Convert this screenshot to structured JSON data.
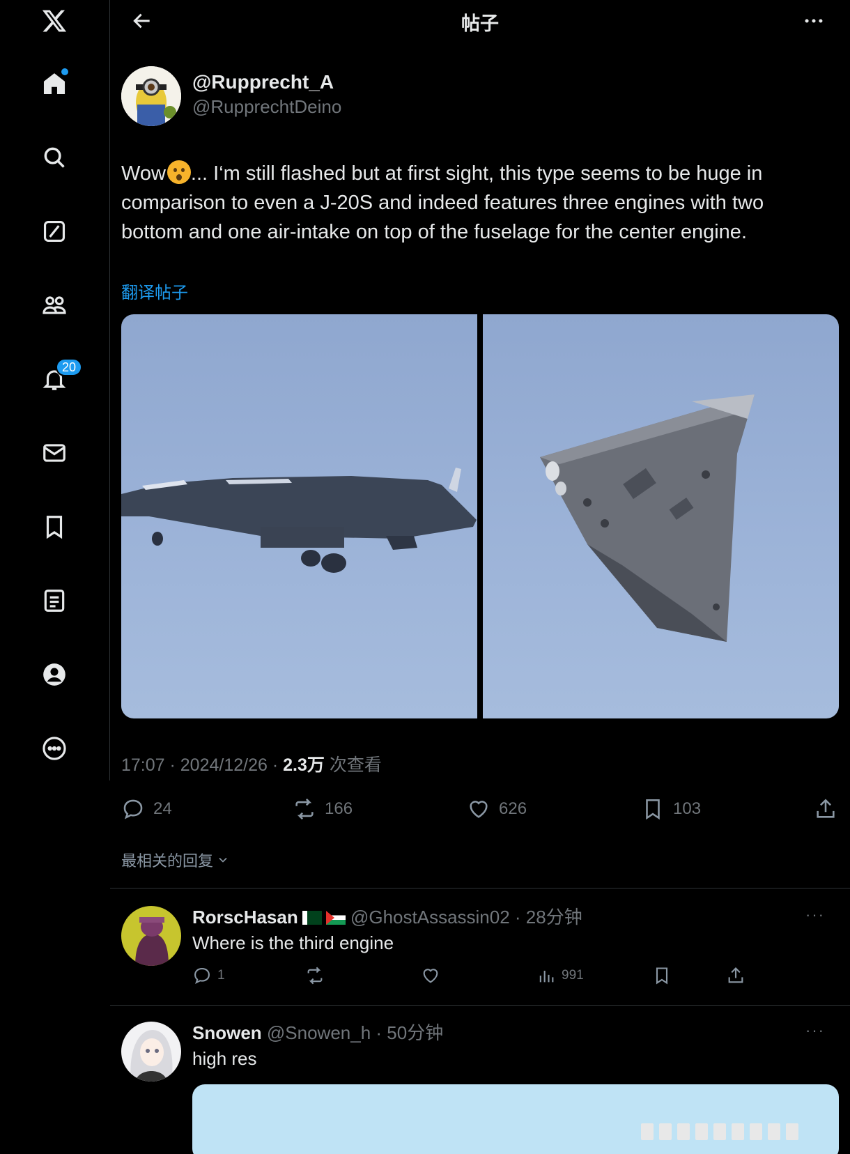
{
  "header": {
    "title": "帖子"
  },
  "sidebar": {
    "items": [
      {
        "icon": "x-logo-icon"
      },
      {
        "icon": "home-icon"
      },
      {
        "icon": "search-icon"
      },
      {
        "icon": "grok-icon"
      },
      {
        "icon": "communities-icon"
      },
      {
        "icon": "notifications-icon",
        "badge": "20"
      },
      {
        "icon": "messages-icon"
      },
      {
        "icon": "bookmarks-icon"
      },
      {
        "icon": "lists-icon"
      },
      {
        "icon": "profile-icon"
      },
      {
        "icon": "more-icon"
      }
    ]
  },
  "post": {
    "display_name": "@Rupprecht_A",
    "handle": "@RupprechtDeino",
    "text_before_emoji": "Wow",
    "text_after_emoji": "... I‘m still flashed but at first sight, this type seems to be huge in comparison to even a J-20S and indeed features three engines with two bottom and one air-intake on top of the fuselage for the center engine.",
    "translate_label": "翻译帖子",
    "time": "17:07 · 2024/12/26 · ",
    "views": "2.3万",
    "views_label": " 次查看",
    "stats": {
      "replies": "24",
      "reposts": "166",
      "likes": "626",
      "bookmarks": "103"
    },
    "accent": "#1d9bf0"
  },
  "sort_label": "最相关的回复",
  "replies": [
    {
      "name": "RorscHasan",
      "meta": "@GhostAssassin02 · 28分钟",
      "text": "Where is the third engine",
      "replies": "1",
      "views": "991"
    },
    {
      "name": "Snowen",
      "meta": "@Snowen_h · 50分钟",
      "text": "high res"
    }
  ]
}
